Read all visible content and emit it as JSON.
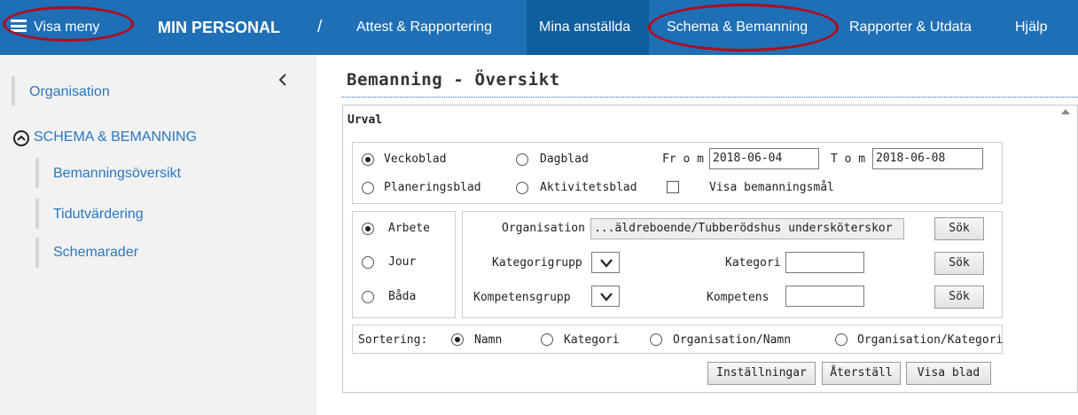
{
  "topbar": {
    "menu_label": "Visa meny",
    "app_title": "MIN PERSONAL",
    "separator": "/",
    "nav": [
      "Attest & Rapportering",
      "Mina anställda",
      "Schema & Bemanning",
      "Rapporter & Utdata",
      "Hjälp"
    ],
    "active_nav": "Mina anställda",
    "colors": {
      "bar": "#1f6fb6",
      "active": "#0f5e9e",
      "highlight_ring": "#b20b1a"
    }
  },
  "sidebar": {
    "organisation": "Organisation",
    "section_title": "SCHEMA & BEMANNING",
    "items": [
      "Bemanningsöversikt",
      "Tidutvärdering",
      "Schemarader"
    ],
    "link_color": "#2a77c0"
  },
  "main": {
    "title": "Bemanning - Översikt",
    "urval_label": "Urval",
    "view_options": {
      "veckoblad": "Veckoblad",
      "dagblad": "Dagblad",
      "planeringsblad": "Planeringsblad",
      "aktivitetsblad": "Aktivitetsblad",
      "visa_bemanningsmal": "Visa bemanningsmål",
      "selected": "Veckoblad",
      "visa_bemanningsmal_checked": false
    },
    "date_range": {
      "from_label": "Fr o m",
      "from_value": "2018-06-04",
      "to_label": "T o m",
      "to_value": "2018-06-08"
    },
    "type_options": {
      "arbete": "Arbete",
      "jour": "Jour",
      "bada": "Båda",
      "selected": "Arbete"
    },
    "filters": {
      "organisation_label": "Organisation",
      "organisation_value": "...äldreboende/Tubberödshus undersköterskor",
      "kategorigrupp_label": "Kategorigrupp",
      "kategori_label": "Kategori",
      "kategori_value": "",
      "kompetensgrupp_label": "Kompetensgrupp",
      "kompetens_label": "Kompetens",
      "kompetens_value": "",
      "search_label": "Sök"
    },
    "sorting": {
      "label": "Sortering:",
      "options": [
        "Namn",
        "Kategori",
        "Organisation/Namn",
        "Organisation/Kategori"
      ],
      "selected": "Namn"
    },
    "buttons": {
      "installningar": "Inställningar",
      "aterstall": "Återställ",
      "visa_blad": "Visa blad"
    }
  }
}
